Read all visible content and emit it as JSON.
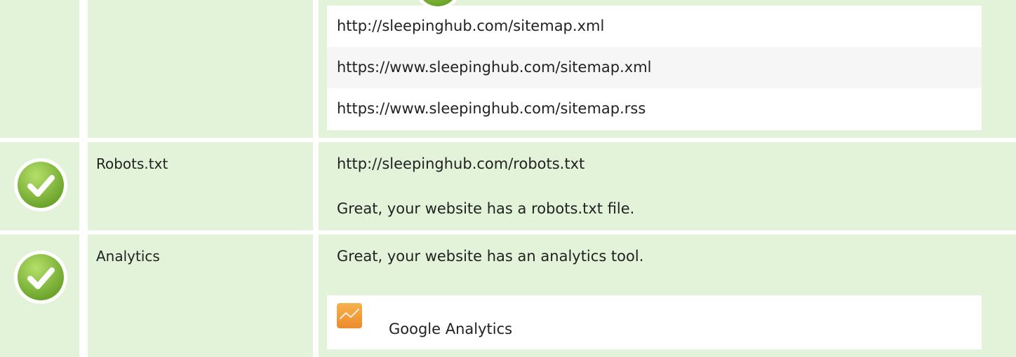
{
  "sitemap": {
    "urls": [
      "http://sleepinghub.com/sitemap.xml",
      "https://www.sleepinghub.com/sitemap.xml",
      "https://www.sleepinghub.com/sitemap.rss"
    ]
  },
  "robots": {
    "label": "Robots.txt",
    "url": "http://sleepinghub.com/robots.txt",
    "message": "Great, your website has a robots.txt file.",
    "status_icon": "check-icon"
  },
  "analytics": {
    "label": "Analytics",
    "message": "Great, your website has an analytics tool.",
    "status_icon": "check-icon",
    "tool": {
      "name": "Google Analytics",
      "icon": "google-analytics-icon"
    }
  },
  "colors": {
    "row_background": "#e3f3d9",
    "check_green": "#8cc63f",
    "analytics_orange": "#f49b3a"
  }
}
